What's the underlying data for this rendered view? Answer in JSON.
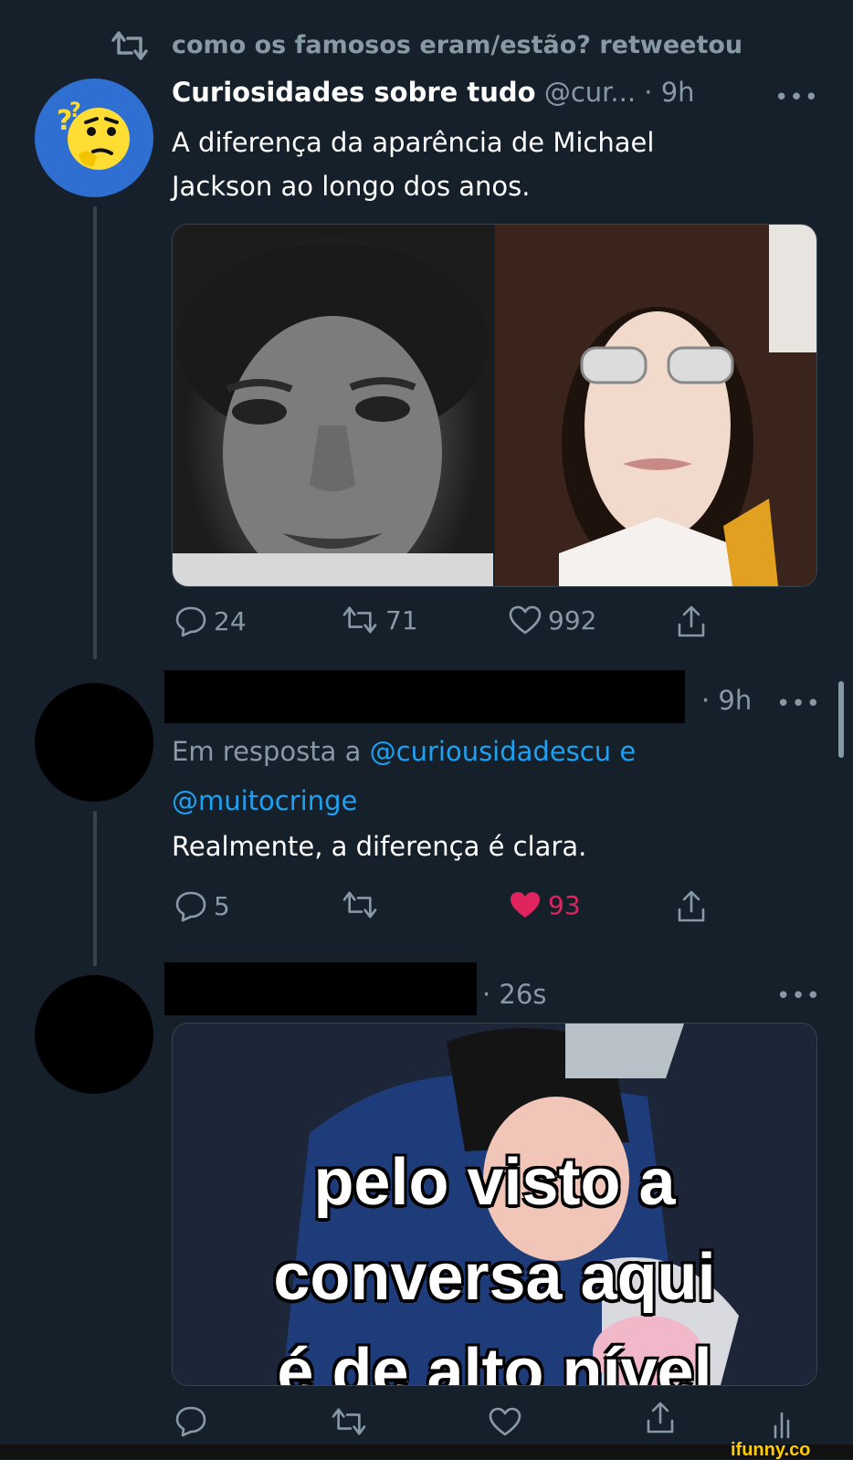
{
  "retweet_context": {
    "text": "como os famosos eram/estão? retweetou",
    "icon": "retweet-icon"
  },
  "tweet1": {
    "display_name": "Curiosidades sobre tudo",
    "handle": "@cur...",
    "time": "· 9h",
    "more": "•••",
    "text_line1": "A diferença da aparência de Michael",
    "text_line2": "Jackson ao longo dos anos.",
    "avatar_icon": "thinking-face-icon",
    "avatar_color": "#2f6fd1",
    "actions": {
      "reply": "24",
      "retweet": "71",
      "like": "992"
    }
  },
  "tweet2": {
    "time": "· 9h",
    "more": "•••",
    "reply_prefix": "Em resposta a",
    "mention1": "@curiousidadescu",
    "conj": "e",
    "mention2": "@muitocringe",
    "text": "Realmente, a diferença é clara.",
    "actions": {
      "reply": "5",
      "retweet": "",
      "like": "93"
    },
    "like_color": "#e0245e"
  },
  "tweet3": {
    "time": "· 26s",
    "more": "•••",
    "meme_line1": "pelo visto a",
    "meme_line2": "conversa aqui",
    "meme_line3": "é de alto nível"
  },
  "watermark": {
    "text": "ifunny.co"
  },
  "colors": {
    "background": "#15202b",
    "muted": "#8899a6",
    "link": "#1da1f2",
    "divider": "#38444d"
  }
}
